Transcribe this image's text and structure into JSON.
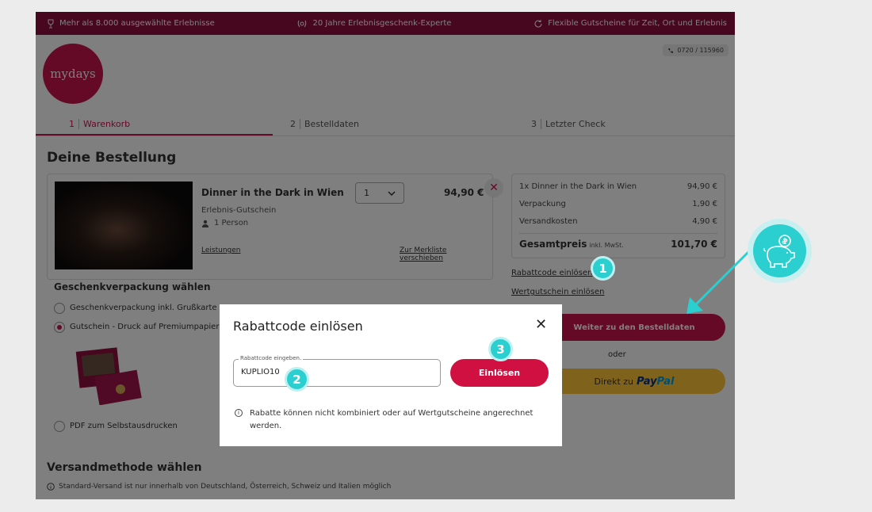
{
  "topbar": {
    "item1": "Mehr als 8.000 ausgewählte Erlebnisse",
    "item2": "20 Jahre Erlebnisgeschenk-Experte",
    "item3": "Flexible Gutscheine für Zeit, Ort und Erlebnis"
  },
  "brand": {
    "logo": "mydays",
    "phone": "0720 / 115960"
  },
  "steps": [
    {
      "num": "1",
      "label": "Warenkorb",
      "active": true
    },
    {
      "num": "2",
      "label": "Bestelldaten",
      "active": false
    },
    {
      "num": "3",
      "label": "Letzter Check",
      "active": false
    }
  ],
  "order": {
    "heading": "Deine Bestellung",
    "product": {
      "name": "Dinner in the Dark in Wien",
      "type": "Erlebnis-Gutschein",
      "persons": "1 Person",
      "qty": "1",
      "price": "94,90 €",
      "remove": "✕",
      "link_services": "Leistungen",
      "link_wishlist": "Zur Merkliste verschieben"
    },
    "gift": {
      "heading": "Geschenkverpackung wählen",
      "opt1": "Geschenkverpackung inkl. Grußkarte",
      "opt2": "Gutschein - Druck auf Premiumpapier",
      "opt3": "PDF zum Selbstausdrucken"
    },
    "shipping": {
      "heading": "Versandmethode wählen",
      "note": "Standard-Versand ist nur innerhalb von Deutschland, Österreich, Schweiz und Italien möglich"
    }
  },
  "summary": {
    "line1_label": "1x Dinner in the Dark in Wien",
    "line1_value": "94,90 €",
    "line2_label": "Verpackung",
    "line2_value": "1,90 €",
    "line3_label": "Versandkosten",
    "line3_value": "4,90 €",
    "total_label": "Gesamtpreis",
    "total_incl": "inkl. MwSt.",
    "total_value": "101,70 €",
    "link_discount": "Rabattcode einlösen",
    "link_voucher": "Wertgutschein einlösen",
    "btn_next": "Weiter zu den Bestelldaten",
    "or": "oder",
    "btn_paypal_prefix": "Direkt zu",
    "paypal_pay": "Pay",
    "paypal_pal": "Pal"
  },
  "modal": {
    "title": "Rabattcode einlösen",
    "close": "✕",
    "field_label": "Rabattcode eingeben.",
    "field_value": "KUPLIO10",
    "button": "Einlösen",
    "note_icon": "i",
    "note": "Rabatte können nicht kombiniert oder auf Wertgutscheine angerechnet werden."
  },
  "badges": {
    "b1": "1",
    "b2": "2",
    "b3": "3"
  },
  "icons": [
    "trophy-icon",
    "laurel-icon",
    "refresh-icon",
    "phone-icon",
    "person-icon",
    "info-icon",
    "close-icon",
    "chevron-down-icon",
    "piggy-bank-icon",
    "arrow-icon"
  ],
  "colors": {
    "brand": "#8f0f3e",
    "accent": "#c8154f",
    "teal": "#2ccfd0",
    "paypal_yellow": "#fec439"
  }
}
